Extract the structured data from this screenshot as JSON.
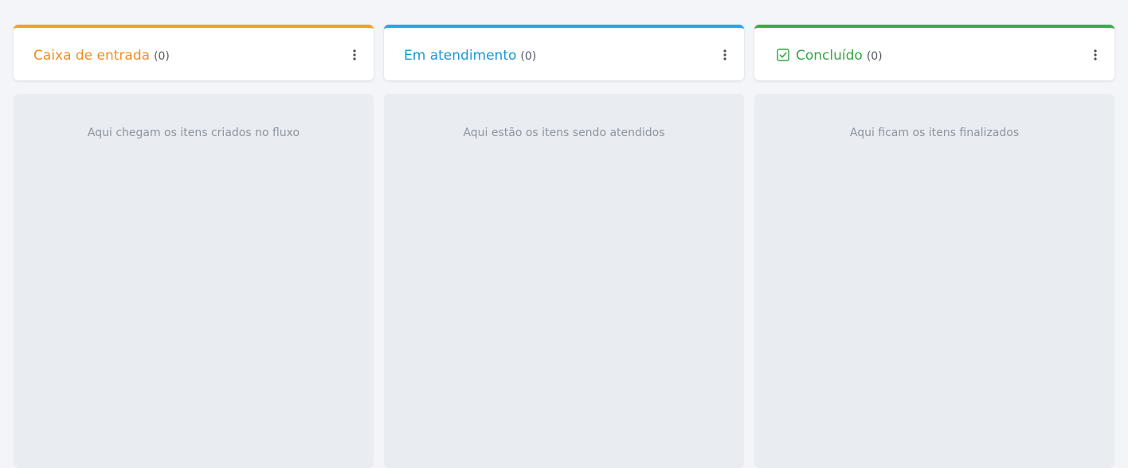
{
  "columns": [
    {
      "title": "Caixa de entrada",
      "count": "(0)",
      "accent": "#f4a024",
      "empty_message": "Aqui chegam os itens criados no fluxo",
      "menu_icon": "more-vertical-icon"
    },
    {
      "title": "Em atendimento",
      "count": "(0)",
      "accent": "#22a7ec",
      "empty_message": "Aqui estão os itens sendo atendidos",
      "menu_icon": "more-vertical-icon"
    },
    {
      "title": "Concluído",
      "count": "(0)",
      "accent": "#3aac4a",
      "title_icon": "checkbox-checked-icon",
      "empty_message": "Aqui ficam os itens finalizados",
      "menu_icon": "more-vertical-icon"
    }
  ]
}
